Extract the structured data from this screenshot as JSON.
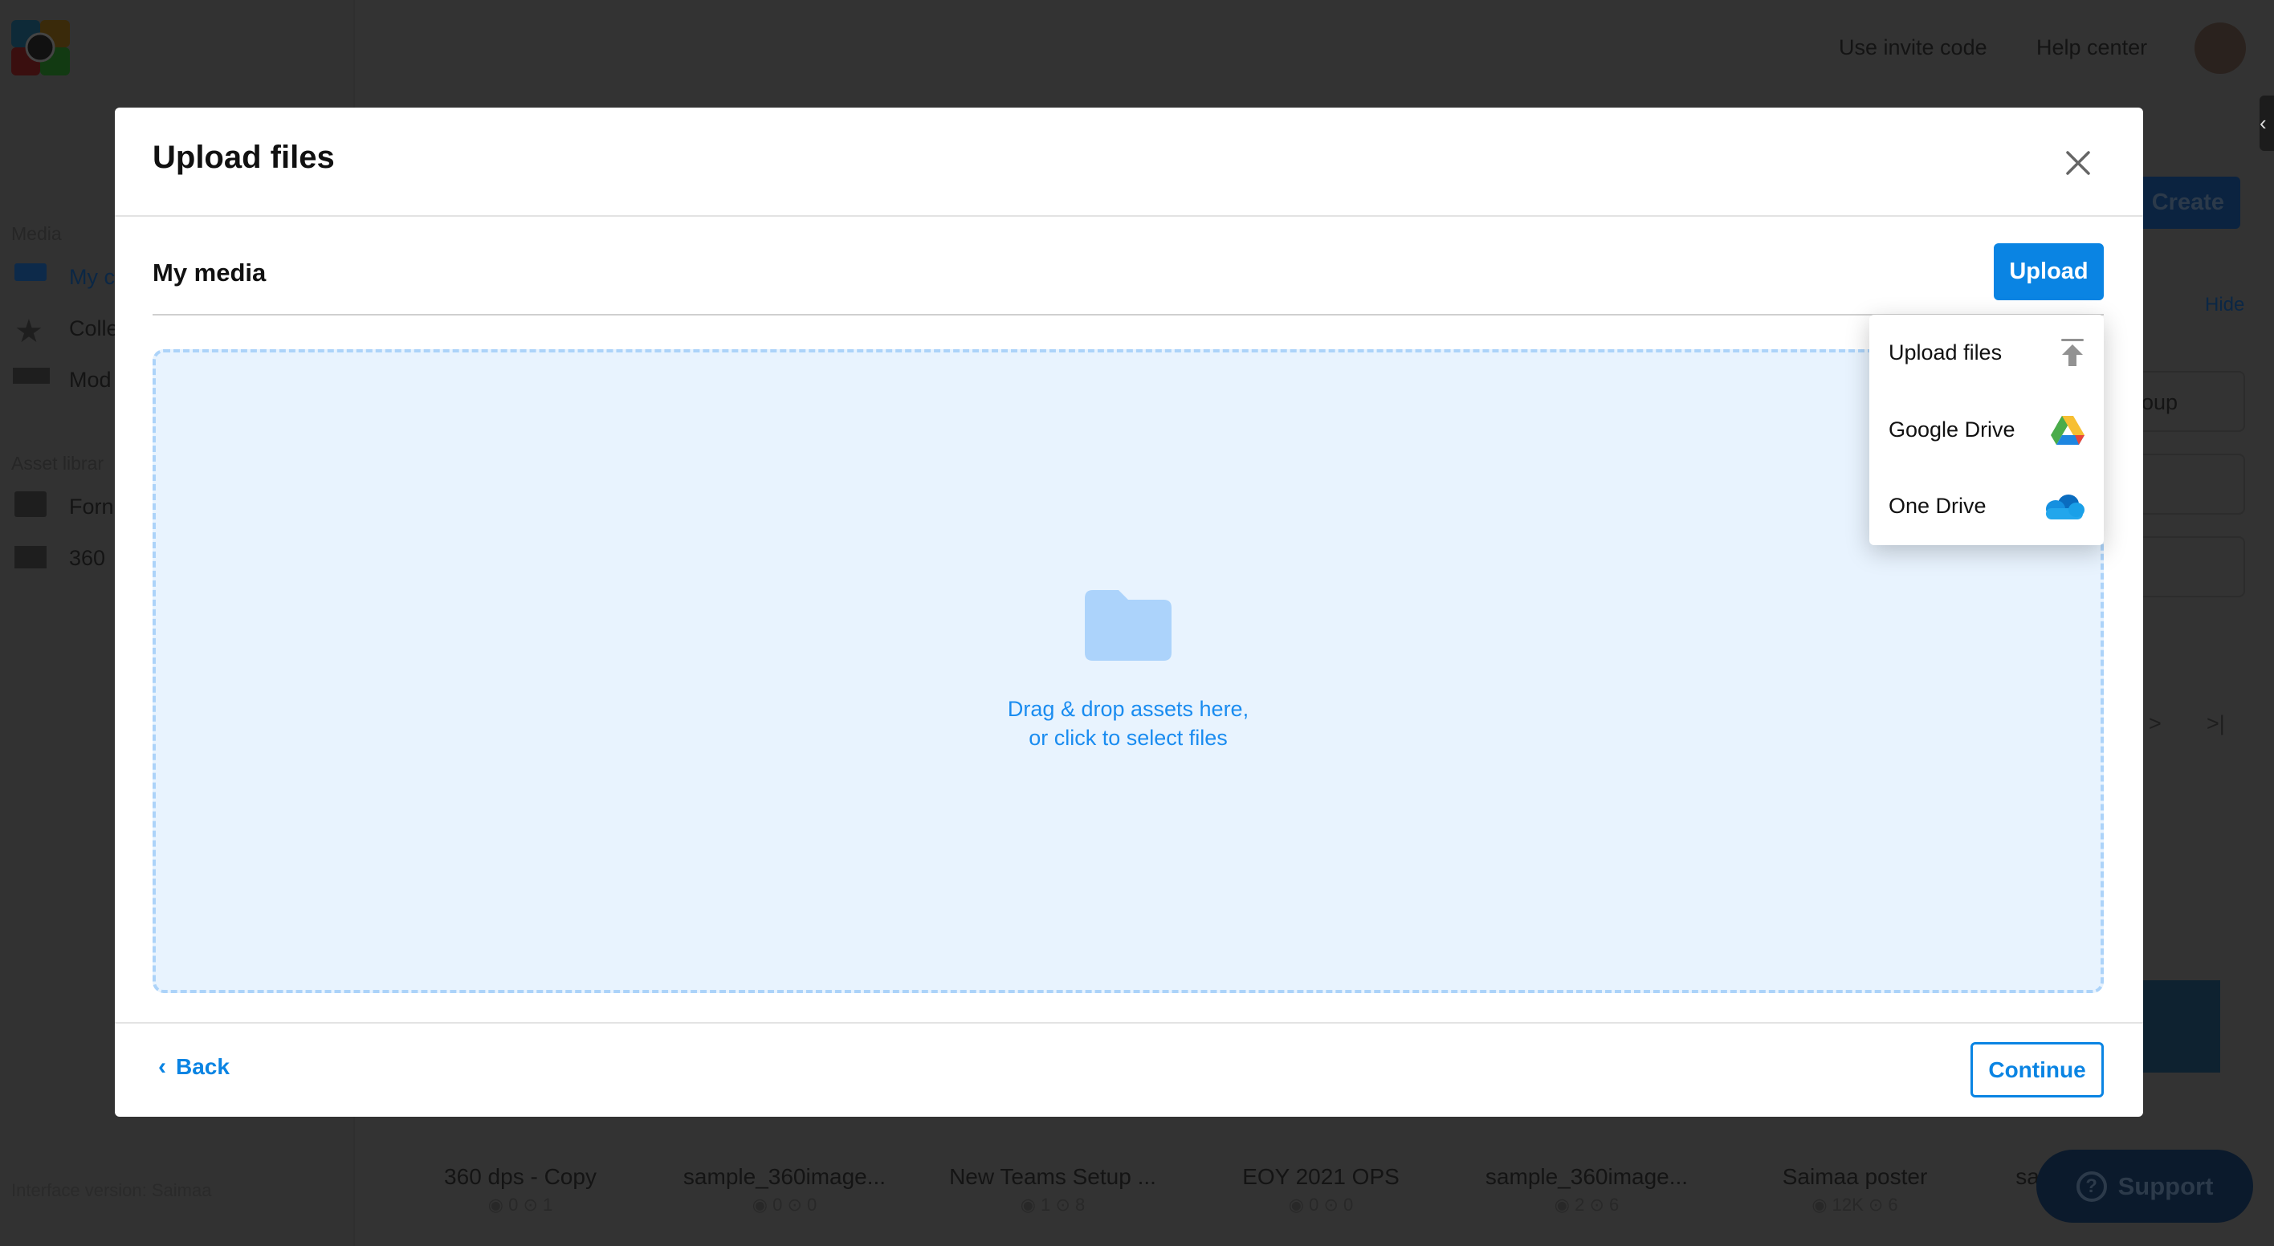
{
  "background": {
    "header": {
      "invite_link": "Use invite code",
      "help_link": "Help center"
    },
    "sidebar": {
      "media_heading": "Media",
      "items": [
        {
          "label": "My c"
        },
        {
          "label": "Colle"
        },
        {
          "label": "Mod"
        }
      ],
      "asset_heading": "Asset librar",
      "asset_items": [
        {
          "label": "Forn"
        },
        {
          "label": "360"
        }
      ],
      "version": "Interface version: Saimaa"
    },
    "create_label": "Create",
    "hide_label": "Hide",
    "group_label": "oup",
    "pager": {
      "next": ">",
      "last": ">|"
    },
    "media_items": [
      {
        "name": "360 dps - Copy",
        "stats": "◉ 0  ⊙ 1"
      },
      {
        "name": "sample_360image...",
        "stats": "◉ 0  ⊙ 0"
      },
      {
        "name": "New Teams Setup ...",
        "stats": "◉ 1  ⊙ 8"
      },
      {
        "name": "EOY 2021 OPS",
        "stats": "◉ 0  ⊙ 0"
      },
      {
        "name": "sample_360image...",
        "stats": "◉ 2  ⊙ 6"
      },
      {
        "name": "Saimaa poster",
        "stats": "◉ 12K  ⊙ 6"
      },
      {
        "name": "sa",
        "stats": ""
      }
    ],
    "support_label": "Support"
  },
  "modal": {
    "title": "Upload files",
    "section_title": "My media",
    "upload_button": "Upload",
    "dropzone": {
      "line1": "Drag & drop assets here,",
      "line2": "or click to select files"
    },
    "back_label": "Back",
    "continue_label": "Continue",
    "upload_menu": [
      {
        "label": "Upload files",
        "icon": "upload-icon"
      },
      {
        "label": "Google Drive",
        "icon": "google-drive-icon"
      },
      {
        "label": "One Drive",
        "icon": "onedrive-icon"
      }
    ]
  },
  "colors": {
    "accent": "#0a84e3",
    "dropzone_bg": "#e8f3fe",
    "dropzone_border": "#acd3f9",
    "overlay": "#333333"
  }
}
